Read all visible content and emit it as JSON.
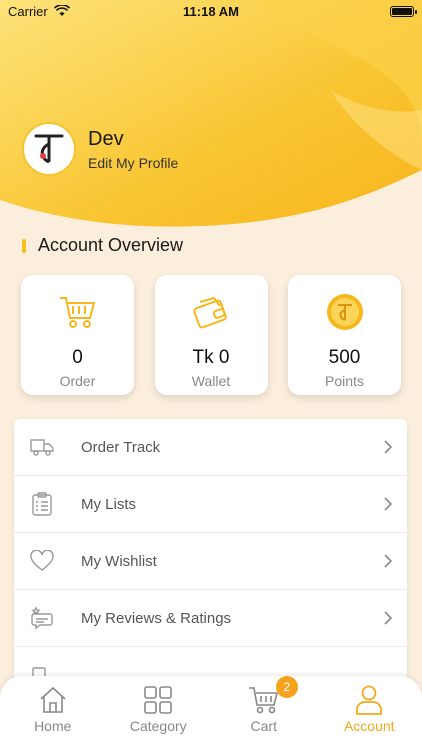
{
  "status_bar": {
    "carrier": "Carrier",
    "time": "11:18 AM"
  },
  "profile": {
    "name": "Dev",
    "edit_label": "Edit My Profile"
  },
  "section": {
    "title": "Account Overview"
  },
  "cards": [
    {
      "value": "0",
      "label": "Order",
      "icon": "cart-icon"
    },
    {
      "value": "Tk 0",
      "label": "Wallet",
      "icon": "wallet-icon"
    },
    {
      "value": "500",
      "label": "Points",
      "icon": "coin-icon"
    }
  ],
  "menu": [
    {
      "label": "Order Track",
      "icon": "truck-icon"
    },
    {
      "label": "My Lists",
      "icon": "clipboard-list-icon"
    },
    {
      "label": "My Wishlist",
      "icon": "heart-icon"
    },
    {
      "label": "My Reviews & Ratings",
      "icon": "review-chat-icon"
    }
  ],
  "tabs": [
    {
      "label": "Home",
      "icon": "home-icon"
    },
    {
      "label": "Category",
      "icon": "grid-icon"
    },
    {
      "label": "Cart",
      "icon": "cart-icon",
      "badge": "2"
    },
    {
      "label": "Account",
      "icon": "person-icon",
      "active": true
    }
  ],
  "colors": {
    "accent": "#f7b71c",
    "background": "#fbeedd",
    "active_tab": "#f3a91a"
  }
}
